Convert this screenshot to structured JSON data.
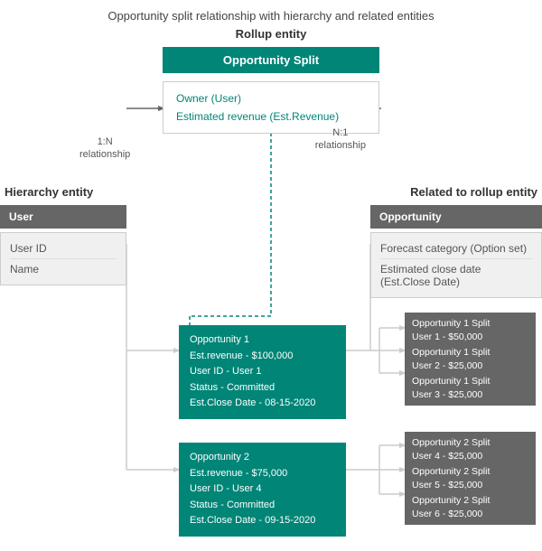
{
  "page": {
    "title": "Opportunity split relationship with hierarchy and related entities"
  },
  "rollup": {
    "section_label": "Rollup entity",
    "box_title": "Opportunity Split",
    "fields": [
      {
        "text": "Owner (User)",
        "style": "teal"
      },
      {
        "text": "Estimated revenue (Est.Revenue)",
        "style": "teal"
      }
    ]
  },
  "hierarchy": {
    "section_label": "Hierarchy entity",
    "box_title": "User",
    "fields": [
      "User ID",
      "Name"
    ]
  },
  "related": {
    "section_label": "Related to rollup entity",
    "box_title": "Opportunity",
    "fields": [
      "Forecast category (Option set)",
      "Estimated close date (Est.Close Date)"
    ]
  },
  "rel_left": {
    "line1": "1:N",
    "line2": "relationship"
  },
  "rel_right": {
    "line1": "N:1",
    "line2": "relationship"
  },
  "opportunities": [
    {
      "id": "opp1",
      "lines": [
        "Opportunity 1",
        "Est.revenue - $100,000",
        "User ID - User 1",
        "Status - Committed",
        "Est.Close Date - 08-15-2020"
      ],
      "splits": [
        "Opportunity 1 Split\nUser 1 - $50,000",
        "Opportunity 1 Split\nUser 2 - $25,000",
        "Opportunity 1 Split\nUser 3 - $25,000"
      ]
    },
    {
      "id": "opp2",
      "lines": [
        "Opportunity 2",
        "Est.revenue - $75,000",
        "User ID - User 4",
        "Status - Committed",
        "Est.Close Date - 09-15-2020"
      ],
      "splits": [
        "Opportunity 2 Split\nUser 4 - $25,000",
        "Opportunity 2 Split\nUser 5 - $25,000",
        "Opportunity 2 Split\nUser 6 - $25,000"
      ]
    }
  ]
}
